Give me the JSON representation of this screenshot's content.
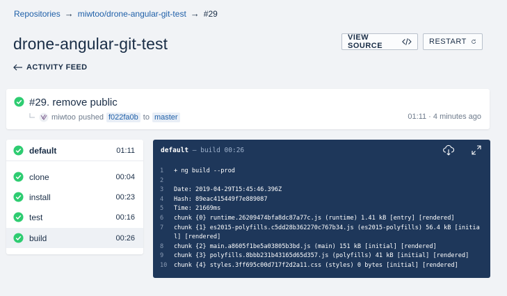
{
  "breadcrumb": {
    "root": "Repositories",
    "repo": "miwtoo/drone-angular-git-test",
    "build": "#29",
    "arrow": "→"
  },
  "page_title": "drone-angular-git-test",
  "buttons": {
    "view_source": "VIEW SOURCE",
    "restart": "RESTART"
  },
  "back_link": "ACTIVITY FEED",
  "commit": {
    "title": "#29. remove public",
    "author": "miwtoo",
    "action": "pushed",
    "sha": "f022fa0b",
    "to": "to",
    "branch": "master",
    "time": "01:11 · 4 minutes ago",
    "status_color": "#2ecc71"
  },
  "stage": {
    "name": "default",
    "duration": "01:11"
  },
  "steps": [
    {
      "name": "clone",
      "duration": "00:04"
    },
    {
      "name": "install",
      "duration": "00:23"
    },
    {
      "name": "test",
      "duration": "00:16"
    },
    {
      "name": "build",
      "duration": "00:26"
    }
  ],
  "log": {
    "stage": "default",
    "separator": " — ",
    "step": "build 00:26",
    "lines": [
      {
        "n": "1",
        "text": "+ ng build --prod"
      },
      {
        "n": "2",
        "text": ""
      },
      {
        "n": "3",
        "text": "Date: 2019-04-29T15:45:46.396Z"
      },
      {
        "n": "4",
        "text": "Hash: 89eac415449f7e889087"
      },
      {
        "n": "5",
        "text": "Time: 21669ms"
      },
      {
        "n": "6",
        "text": "chunk {0} runtime.26209474bfa8dc87a77c.js (runtime) 1.41 kB [entry] [rendered]"
      },
      {
        "n": "7",
        "text": "chunk {1} es2015-polyfills.c5dd28b362270c767b34.js (es2015-polyfills) 56.4 kB [initial] [rendered]"
      },
      {
        "n": "8",
        "text": "chunk {2} main.a8605f1be5a03805b3bd.js (main) 151 kB [initial] [rendered]"
      },
      {
        "n": "9",
        "text": "chunk {3} polyfills.8bbb231b43165d65d357.js (polyfills) 41 kB [initial] [rendered]"
      },
      {
        "n": "10",
        "text": "chunk {4} styles.3ff695c00d717f2d2a11.css (styles) 0 bytes [initial] [rendered]"
      }
    ]
  }
}
